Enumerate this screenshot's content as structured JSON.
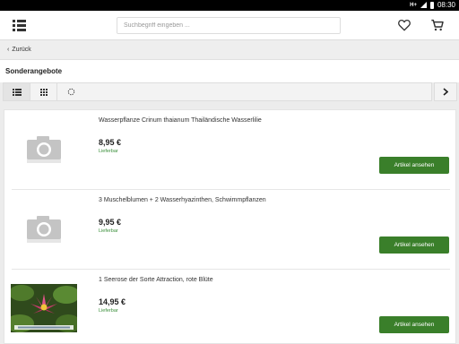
{
  "status_bar": {
    "network": "H+",
    "time": "08:30"
  },
  "header": {
    "menu_icon": "menu-icon",
    "search_placeholder": "Suchbegriff eingeben ...",
    "wishlist_icon": "heart-icon",
    "cart_icon": "cart-icon"
  },
  "navigation": {
    "back_label": "Zurück"
  },
  "page": {
    "title": "Sonderangebote"
  },
  "toolbar": {
    "list_view_icon": "list-view-icon",
    "grid_view_icon": "grid-view-icon",
    "refresh_icon": "refresh-icon",
    "next_icon": "chevron-right-icon"
  },
  "products": [
    {
      "name": "Wasserpflanze Crinum thaianum Thailändische Wasserlilie",
      "price": "8,95 €",
      "availability": "Lieferbar",
      "button_label": "Artikel ansehen",
      "image": "camera-placeholder-icon"
    },
    {
      "name": "3 Muschelblumen + 2 Wasserhyazinthen, Schwimmpflanzen",
      "price": "9,95 €",
      "availability": "Lieferbar",
      "button_label": "Artikel ansehen",
      "image": "camera-placeholder-icon"
    },
    {
      "name": "1 Seerose der Sorte Attraction, rote Blüte",
      "price": "14,95 €",
      "availability": "Lieferbar",
      "button_label": "Artikel ansehen",
      "image": "water-lily-photo"
    }
  ],
  "colors": {
    "button_green": "#3a7f2a",
    "availability_green": "#3a8f3a"
  }
}
